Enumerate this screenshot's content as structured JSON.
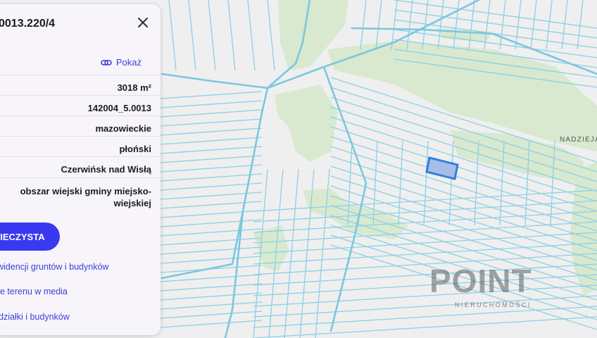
{
  "map": {
    "place_label": "NADZIEJA",
    "colors": {
      "background": "#efefef",
      "forest": "#d8e9cf",
      "parcel_line": "#8cd0e6",
      "road": "#7cc7df",
      "selected_fill": "#a8bde6",
      "selected_stroke": "#2f7fe0"
    }
  },
  "panel": {
    "title": "0013.220/4",
    "close_icon": "close-icon",
    "show_label": "Pokaż",
    "rows": [
      {
        "value": "3018 m²"
      },
      {
        "value": "142004_5.0013"
      },
      {
        "value": "mazowieckie"
      },
      {
        "value": "płoński"
      },
      {
        "value": "Czerwińsk nad Wisłą"
      },
      {
        "value_line1": "obszar wiejski gminy miejsko-",
        "value_line2": "wiejskiej"
      }
    ],
    "button_label": "WIECZYSTA",
    "links": [
      "widencji gruntów i budynków",
      "e terenu w media",
      "działki i budynków"
    ],
    "accent": "#3a39ef"
  },
  "watermark": {
    "text": "POINT",
    "subtitle": "NIERUCHOMOŚCI"
  }
}
